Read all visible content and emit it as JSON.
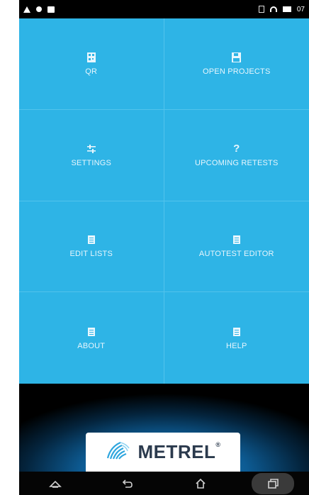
{
  "status_bar": {
    "left_icons": [
      "alert-icon",
      "dot-icon",
      "notification-icon"
    ],
    "right_icons": [
      "sim-icon",
      "wifi-icon",
      "battery-icon"
    ],
    "time": "07"
  },
  "menu": {
    "tiles": [
      {
        "label": "QR",
        "icon": "qr-icon"
      },
      {
        "label": "OPEN PROJECTS",
        "icon": "save-icon"
      },
      {
        "label": "SETTINGS",
        "icon": "settings-icon"
      },
      {
        "label": "UPCOMING RETESTS",
        "icon": "question-icon"
      },
      {
        "label": "EDIT LISTS",
        "icon": "document-icon"
      },
      {
        "label": "AUTOTEST EDITOR",
        "icon": "document-icon"
      },
      {
        "label": "ABOUT",
        "icon": "document-icon"
      },
      {
        "label": "HELP",
        "icon": "document-icon"
      }
    ]
  },
  "brand": {
    "name": "METREL",
    "registered": "®"
  },
  "nav_bar": {
    "buttons": [
      "home-outline-icon",
      "back-icon",
      "home-icon",
      "recent-apps-icon"
    ]
  },
  "colors": {
    "tile_background": "#2eb4e6",
    "tile_text": "#e8f6fd",
    "logo_text": "#2b3a4d",
    "nav_background": "#050505"
  }
}
